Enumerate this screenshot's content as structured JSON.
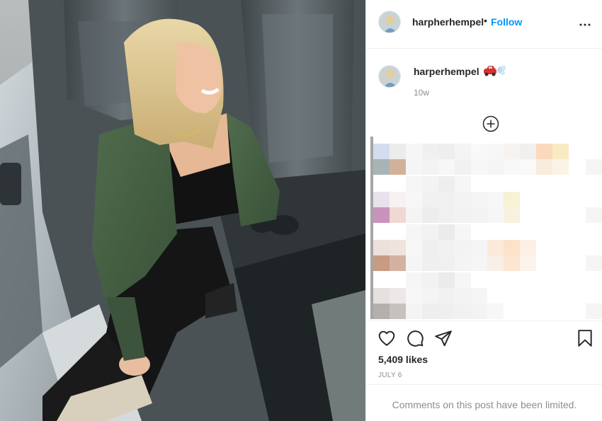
{
  "post": {
    "author": "harpherhempel",
    "follow_separator": "•",
    "follow_label": "Follow",
    "caption_username": "harperhempel",
    "caption_emoji": "car-dash-emoji",
    "time_ago": "10w",
    "likes": "5,409 likes",
    "date": "JULY 6",
    "comments_notice": "Comments on this post have been limited."
  },
  "icons": {
    "more": "more-options-icon",
    "load_more": "plus-circle-icon",
    "like": "heart-icon",
    "comment": "comment-icon",
    "share": "send-icon",
    "save": "bookmark-icon"
  },
  "colors": {
    "accent": "#0095f6",
    "text": "#262626",
    "muted": "#8e8e8e",
    "border": "#efefef"
  }
}
